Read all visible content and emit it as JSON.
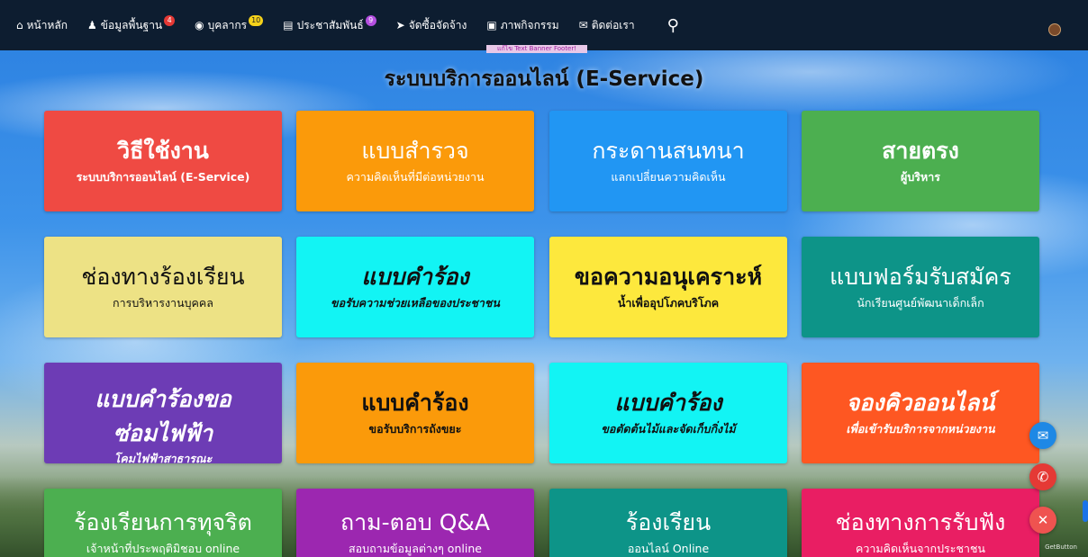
{
  "nav": {
    "items": [
      {
        "icon": "home-icon",
        "glyph": "⌂",
        "label": "หน้าหลัก"
      },
      {
        "icon": "bell-icon",
        "glyph": "♟",
        "label": "ข้อมูลพื้นฐาน",
        "badge": "4",
        "badge_color": "#e53935"
      },
      {
        "icon": "user-circle-icon",
        "glyph": "◉",
        "label": "บุคลากร",
        "badge": "10",
        "badge_color": "#f5d21a"
      },
      {
        "icon": "newspaper-icon",
        "glyph": "▤",
        "label": "ประชาสัมพันธ์",
        "badge": "9",
        "badge_color": "#b44fe0"
      },
      {
        "icon": "send-icon",
        "glyph": "➤",
        "label": "จัดซื้อจัดจ้าง"
      },
      {
        "icon": "image-icon",
        "glyph": "▣",
        "label": "ภาพกิจกรรม"
      },
      {
        "icon": "envelope-icon",
        "glyph": "✉",
        "label": "ติดต่อเรา"
      }
    ],
    "search_glyph": "⚲"
  },
  "banner_footer": "แก้ไข Text Banner Footer!",
  "page_title": "ระบบบริการออนไลน์ (E-Service)",
  "tiles": [
    {
      "title": "วิธีใช้งาน",
      "subtitle": "ระบบบริการออนไลน์ (E-Service)",
      "bg": "#ef4a43"
    },
    {
      "title": "แบบสำรวจ",
      "subtitle": "ความคิดเห็นที่มีต่อหน่วยงาน",
      "bg": "#fb9a0a"
    },
    {
      "title": "กระดานสนทนา",
      "subtitle": "แลกเปลี่ยนความคิดเห็น",
      "bg": "#2196f3"
    },
    {
      "title": "สายตรง",
      "subtitle": "ผู้บริหาร",
      "bg": "#4caf50"
    },
    {
      "title": "ช่องทางร้องเรียน",
      "subtitle": "การบริหารงานบุคคล",
      "bg": "#ede285"
    },
    {
      "title": "แบบคำร้อง",
      "subtitle": "ขอรับความช่วยเหลือของประชาชน",
      "bg": "#12f4f4"
    },
    {
      "title": "ขอความอนุเคราะห์",
      "subtitle": "น้ำเพื่ออุปโภคบริโภค",
      "bg": "#fde83d"
    },
    {
      "title": "แบบฟอร์มรับสมัคร",
      "subtitle": "นักเรียนศูนย์พัฒนาเด็กเล็ก",
      "bg": "#0d9488"
    },
    {
      "title": "แบบคำร้องขอซ่อมไฟฟ้า",
      "subtitle": "โคมไฟฟ้าสาธารณะ",
      "bg": "#6d3cb5"
    },
    {
      "title": "แบบคำร้อง",
      "subtitle": "ขอรับบริการถังขยะ",
      "bg": "#fb9a0a"
    },
    {
      "title": "แบบคำร้อง",
      "subtitle": "ขอตัดต้นไม้และจัดเก็บกิ่งไม้",
      "bg": "#12f4f4"
    },
    {
      "title": "จองคิวออนไลน์",
      "subtitle": "เพื่อเข้ารับบริการจากหน่วยงาน",
      "bg": "#fe5722"
    },
    {
      "title": "ร้องเรียนการทุจริต",
      "subtitle": "เจ้าหน้าที่ประพฤติมิชอบ online",
      "bg": "#4caf50"
    },
    {
      "title": "ถาม-ตอบ Q&A",
      "subtitle": "สอบถามข้อมูลต่างๆ online",
      "bg": "#9c27b0"
    },
    {
      "title": "ร้องเรียน",
      "subtitle": "ออนไลน์ Online",
      "bg": "#0d9488"
    },
    {
      "title": "ช่องทางการรับฟัง",
      "subtitle": "ความคิดเห็นจากประชาชน",
      "bg": "#e91e63"
    }
  ],
  "floating": {
    "messenger_glyph": "✉",
    "phone_glyph": "✆",
    "close_glyph": "✕",
    "getbutton_text": "GetButton"
  },
  "colors": {
    "nav_bg": "#0d1d30",
    "messenger": "#1e88e5",
    "phone": "#e53935",
    "close": "#ef5350"
  }
}
